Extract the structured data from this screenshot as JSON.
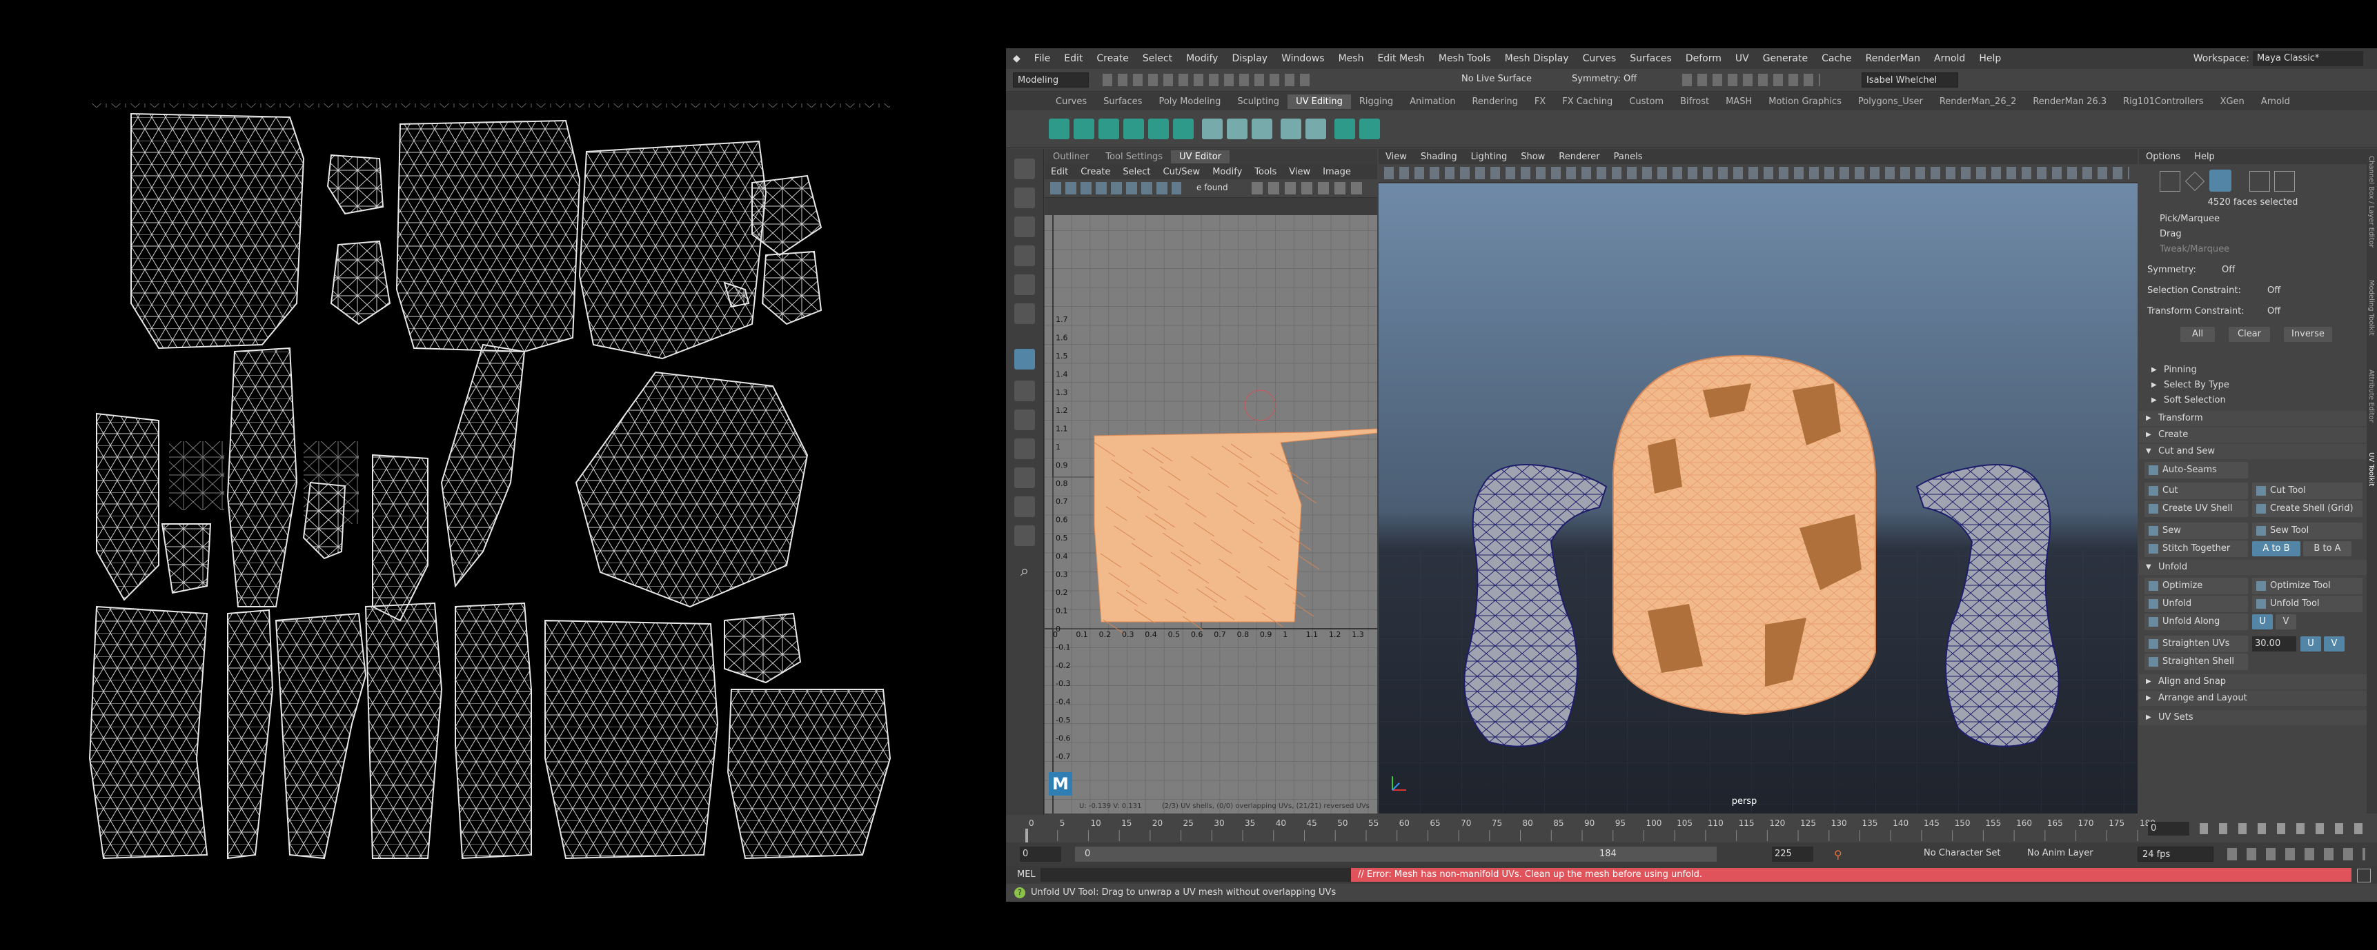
{
  "menubar": {
    "items": [
      "File",
      "Edit",
      "Create",
      "Select",
      "Modify",
      "Display",
      "Windows",
      "Mesh",
      "Edit Mesh",
      "Mesh Tools",
      "Mesh Display",
      "Curves",
      "Surfaces",
      "Deform",
      "UV",
      "Generate",
      "Cache",
      "RenderMan",
      "Arnold",
      "Help"
    ],
    "workspace_label": "Workspace:",
    "workspace_value": "Maya Classic*"
  },
  "statusline": {
    "mode": "Modeling",
    "live_surface": "No Live Surface",
    "symmetry": "Symmetry: Off",
    "user": "Isabel Whelchel"
  },
  "shelf_tabs": [
    "Curves",
    "Surfaces",
    "Poly Modeling",
    "Sculpting",
    "UV Editing",
    "Rigging",
    "Animation",
    "Rendering",
    "FX",
    "FX Caching",
    "Custom",
    "Bifrost",
    "MASH",
    "Motion Graphics",
    "Polygons_User",
    "RenderMan_26_2",
    "RenderMan 26.3",
    "Rig101Controllers",
    "XGen",
    "Arnold"
  ],
  "shelf_active": "UV Editing",
  "uv_panel": {
    "tabs": [
      "Outliner",
      "Tool Settings",
      "UV Editor"
    ],
    "active_tab": "UV Editor",
    "menu": [
      "Edit",
      "Create",
      "Select",
      "Cut/Sew",
      "Modify",
      "Tools",
      "View",
      "Image"
    ],
    "found_text": "e found",
    "y_ticks": [
      "1.7",
      "1.6",
      "1.5",
      "1.4",
      "1.3",
      "1.2",
      "1.1",
      "1",
      "0.9",
      "0.8",
      "0.7",
      "0.6",
      "0.5",
      "0.4",
      "0.3",
      "0.2",
      "0.1",
      "0",
      "-0.1",
      "-0.2",
      "-0.3",
      "-0.4",
      "-0.5",
      "-0.6",
      "-0.7"
    ],
    "x_ticks": [
      "0",
      "0.1",
      "0.2",
      "0.3",
      "0.4",
      "0.5",
      "0.6",
      "0.7",
      "0.8",
      "0.9",
      "1",
      "1.1",
      "1.2",
      "1.3"
    ],
    "status_left": "U: -0.139 V: 0.131",
    "status_right": "(2/3) UV shells, (0/0) overlapping UVs, (21/21) reversed UVs",
    "logo": "M"
  },
  "viewport": {
    "menu": [
      "View",
      "Shading",
      "Lighting",
      "Show",
      "Renderer",
      "Panels"
    ],
    "camera": "persp"
  },
  "right_panel": {
    "menu": [
      "Options",
      "Help"
    ],
    "faces_selected": "4520 faces selected",
    "pick_marquee": "Pick/Marquee",
    "drag": "Drag",
    "tweak_marquee": "Tweak/Marquee",
    "symmetry_label": "Symmetry:",
    "symmetry_value": "Off",
    "sel_constraint_label": "Selection Constraint:",
    "sel_constraint_value": "Off",
    "transform_constraint_label": "Transform Constraint:",
    "transform_constraint_value": "Off",
    "all": "All",
    "clear": "Clear",
    "inverse": "Inverse",
    "pinning": "Pinning",
    "select_by_type": "Select By Type",
    "soft_selection": "Soft Selection",
    "transform": "Transform",
    "create": "Create",
    "cut_and_sew": "Cut and Sew",
    "auto_seams": "Auto-Seams",
    "cut": "Cut",
    "cut_tool": "Cut Tool",
    "create_uv_shell": "Create UV Shell",
    "create_shell_grid": "Create Shell (Grid)",
    "sew": "Sew",
    "sew_tool": "Sew Tool",
    "stitch_together": "Stitch Together",
    "a_to_b": "A to B",
    "b_to_a": "B to A",
    "unfold_section": "Unfold",
    "optimize": "Optimize",
    "optimize_tool": "Optimize Tool",
    "unfold": "Unfold",
    "unfold_tool": "Unfold Tool",
    "unfold_along": "Unfold Along",
    "u": "U",
    "v": "V",
    "straighten_uvs": "Straighten UVs",
    "straighten_value": "30.00",
    "straighten_shell": "Straighten Shell",
    "align_snap": "Align and Snap",
    "arrange_layout": "Arrange and Layout",
    "uv_sets": "UV Sets"
  },
  "side_tabs": [
    "Channel Box / Layer Editor",
    "Modeling Toolkit",
    "Attribute Editor",
    "UV Toolkit"
  ],
  "timeline": {
    "ticks": [
      "0",
      "5",
      "10",
      "15",
      "20",
      "25",
      "30",
      "35",
      "40",
      "45",
      "50",
      "55",
      "60",
      "65",
      "70",
      "75",
      "80",
      "85",
      "90",
      "95",
      "100",
      "105",
      "110",
      "115",
      "120",
      "125",
      "130",
      "135",
      "140",
      "145",
      "150",
      "155",
      "160",
      "165",
      "170",
      "175",
      "180"
    ],
    "current_frame": "0",
    "range_start": "0",
    "range_inner_start": "0",
    "range_inner_end": "184",
    "range_end": "225",
    "character_set": "No Character Set",
    "anim_layer": "No Anim Layer",
    "fps": "24 fps"
  },
  "command_line": {
    "label": "MEL",
    "error": "// Error: Mesh has non-manifold UVs. Clean up the mesh before using unfold."
  },
  "help_line": "Unfold UV Tool: Drag to unwrap a UV mesh without overlapping UVs",
  "colors": {
    "accent": "#5285a6",
    "error": "#e0535a",
    "uv_selected": "#f2b98a"
  }
}
